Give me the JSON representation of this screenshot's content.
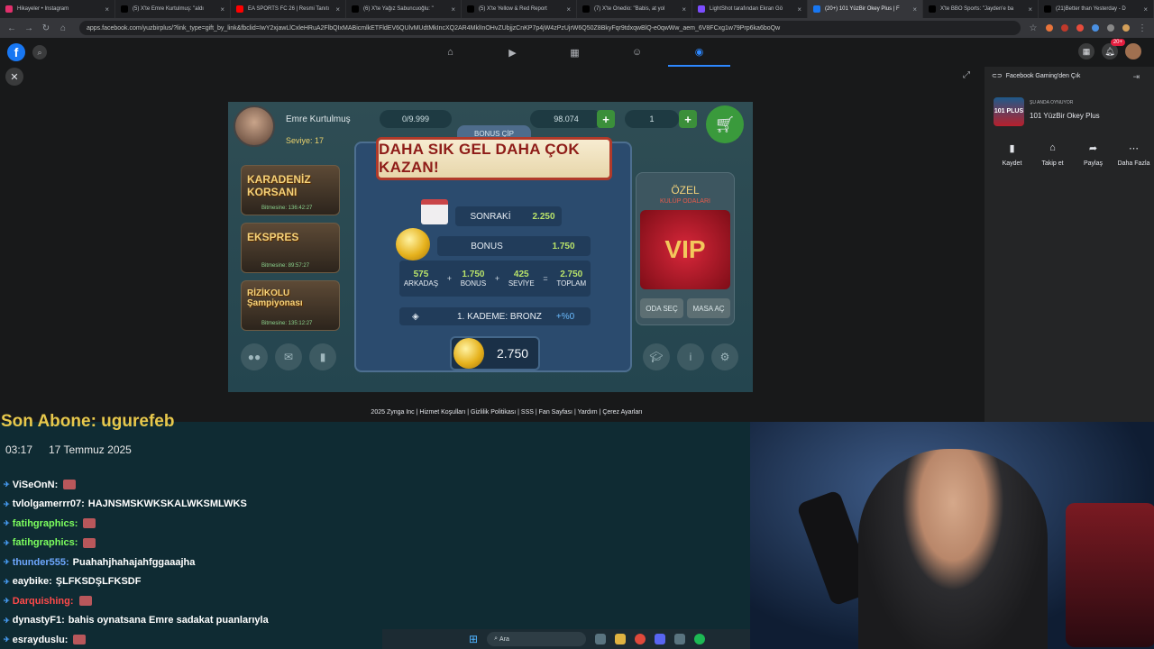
{
  "browser": {
    "tabs": [
      {
        "label": "Hikayeler • Instagram",
        "color": "#e1306c"
      },
      {
        "label": "(5) X'te Emre Kurtulmuş: \"aldı",
        "color": "#000000"
      },
      {
        "label": "EA SPORTS FC 26 | Resmi Tanıtı",
        "color": "#ff0000"
      },
      {
        "label": "(6) X'te Yağız Sabuncuoğlu: \"",
        "color": "#000000"
      },
      {
        "label": "(5) X'te Yellow & Red Report",
        "color": "#000000"
      },
      {
        "label": "(7) X'te Onedio: \"Babis, at yol",
        "color": "#000000"
      },
      {
        "label": "LightShot tarafından Ekran Gö",
        "color": "#7c4dff"
      },
      {
        "label": "(20+) 101 YüzBir Okey Plus | F",
        "color": "#1877f2"
      },
      {
        "label": "X'te BBO Sports: \"Jayden'e ba",
        "color": "#000000"
      },
      {
        "label": "(21)Better than Yesterday - D",
        "color": "#000000"
      }
    ],
    "new_tab": "+",
    "url": "apps.facebook.com/yuzbirplus/?link_type=gift_by_link&fbclid=IwY2xjawLlCxleHRuA2FlbQIxMABicmlkETFldEV6QUlvMUdtMkIncXQ2AR4MklInOHvZUbjjzCnKP7p4jW4zPzUjrW6Q50Z8BkyFqr9tdxqwBlQ-e0qwWw_aem_6V8FCxg1w79Prp6ka6boQw"
  },
  "fb": {
    "logo": "f",
    "nav": [
      "⌂",
      "▶",
      "▦",
      "☺",
      "◉"
    ],
    "notif_badge": "20+"
  },
  "game": {
    "player_name": "Emre Kurtulmuş",
    "player_level": "Seviye: 17",
    "diamonds": "0/9.999",
    "chips": "98.074",
    "tickets": "1",
    "cards": [
      {
        "title": "KARADENİZ KORSANI",
        "timer": "Bitmesine: 136:42:27"
      },
      {
        "title": "EKSPRES",
        "timer": "Bitmesine: 89:57:27"
      },
      {
        "title": "RİZİKOLU Şampiyonası",
        "timer": "Bitmesine: 135:12:27"
      }
    ],
    "vip": {
      "title": "ÖZEL",
      "subtitle": "KULÜP ODALARI",
      "badge": "VIP",
      "btn1": "ODA SEÇ",
      "btn2": "MASA AÇ"
    },
    "popup": {
      "tag": "BONUS ÇİP",
      "banner": "DAHA SIK GEL DAHA ÇOK KAZAN!",
      "next_label": "SONRAKİ",
      "next_value": "2.250",
      "bonus_label": "BONUS",
      "bonus_value": "1.750",
      "calc": [
        {
          "n": "575",
          "l": "ARKADAŞ"
        },
        {
          "n": "1.750",
          "l": "BONUS"
        },
        {
          "n": "425",
          "l": "SEVİYE"
        },
        {
          "n": "2.750",
          "l": "TOPLAM"
        }
      ],
      "ops": [
        "+",
        "+",
        "="
      ],
      "tier": "1. KADEME: BRONZ",
      "tier_pct": "+%0",
      "collect": "2.750"
    }
  },
  "footer": "2025 Zynga Inc | Hizmet Koşulları | Gizlilik Politikası | SSS | Fan Sayfası | Yardım | Çerez Ayarları",
  "panel": {
    "toggle": "Facebook Gaming'den Çık",
    "playing": "ŞU ANDA OYNUYOR",
    "game": "101 YüzBir Okey Plus",
    "thumb": "101 PLUS",
    "actions": [
      {
        "icon": "▮",
        "label": "Kaydet"
      },
      {
        "icon": "⌂",
        "label": "Takip et"
      },
      {
        "icon": "➦",
        "label": "Paylaş"
      },
      {
        "icon": "⋯",
        "label": "Daha Fazla"
      }
    ]
  },
  "stream": {
    "last_sub": "Son Abone: ugurefeb",
    "time": "03:17",
    "date": "17 Temmuz 2025",
    "chat": [
      {
        "u": "ViSeOnN:",
        "t": "",
        "color": "#ffffff",
        "emote": true
      },
      {
        "u": "tvlolgamerrr07:",
        "t": "HAJNSMSKWKSKALWKSMLWKS",
        "color": "#ffffff",
        "emote": false
      },
      {
        "u": "fatihgraphics:",
        "t": "",
        "color": "#7cff5e",
        "emote": true
      },
      {
        "u": "fatihgraphics:",
        "t": "",
        "color": "#7cff5e",
        "emote": true
      },
      {
        "u": "thunder555:",
        "t": "Puahahjhahajahfggaaajha",
        "color": "#6ea8ff",
        "emote": false
      },
      {
        "u": "eaybike:",
        "t": "ŞLFKSDŞLFKSDF",
        "color": "#ffffff",
        "emote": false
      },
      {
        "u": "Darquishing:",
        "t": "",
        "color": "#ff4a4a",
        "emote": true
      },
      {
        "u": "dynastyF1:",
        "t": "bahis oynatsana Emre sadakat puanlarıyla",
        "color": "#ffffff",
        "emote": false
      },
      {
        "u": "esrayduslu:",
        "t": "",
        "color": "#ffffff",
        "emote": true
      }
    ]
  },
  "taskbar": {
    "search": "Ara"
  }
}
